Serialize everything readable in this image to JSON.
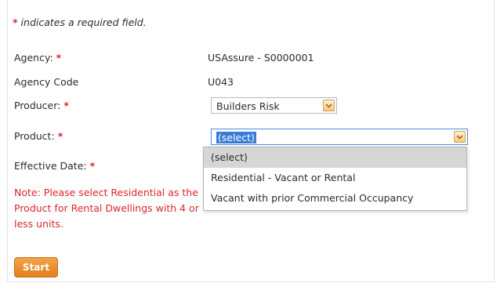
{
  "form": {
    "required_note_star": "*",
    "required_note": "indicates a required field.",
    "agency_label": "Agency:",
    "agency_value": "USAssure - S0000001",
    "agency_code_label": "Agency Code",
    "agency_code_value": "U043",
    "producer_label": "Producer:",
    "producer_value": "Builders Risk",
    "product_label": "Product:",
    "product_value": "(select)",
    "effective_date_label": "Effective Date:",
    "required_star": "*",
    "rental_note": "Note:  Please select Residential as the Product for Rental Dwellings with 4 or less units.",
    "start_label": "Start"
  },
  "product_options": [
    "(select)",
    "Residential - Vacant or Rental",
    "Vacant with prior Commercial Occupancy"
  ],
  "colors": {
    "required": "#d9262c",
    "accent_orange": "#e8891f",
    "focus_blue": "#3a7bd5"
  }
}
